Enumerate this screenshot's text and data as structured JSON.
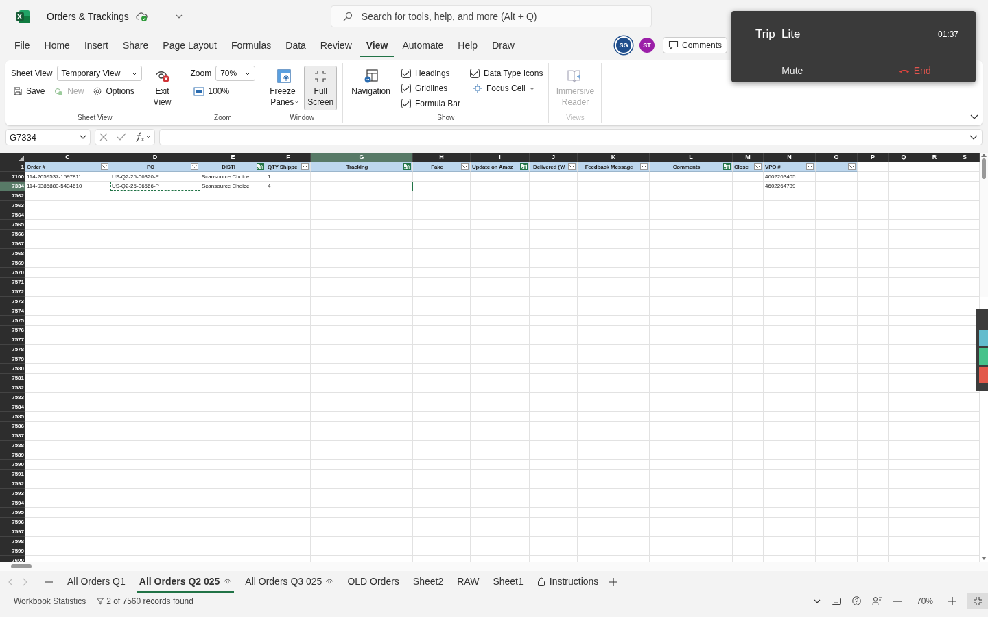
{
  "title_bar": {
    "document_title": "Orders & Trackings",
    "search": {
      "placeholder": "Search for tools, help, and more (Alt + Q)"
    }
  },
  "menu_tabs": [
    {
      "label": "File",
      "selected": false
    },
    {
      "label": "Home",
      "selected": false
    },
    {
      "label": "Insert",
      "selected": false
    },
    {
      "label": "Share",
      "selected": false
    },
    {
      "label": "Page Layout",
      "selected": false
    },
    {
      "label": "Formulas",
      "selected": false
    },
    {
      "label": "Data",
      "selected": false
    },
    {
      "label": "Review",
      "selected": false
    },
    {
      "label": "View",
      "selected": true
    },
    {
      "label": "Automate",
      "selected": false
    },
    {
      "label": "Help",
      "selected": false
    },
    {
      "label": "Draw",
      "selected": false
    }
  ],
  "collaborators": [
    {
      "initials": "SG",
      "color": "#1f4e8c"
    },
    {
      "initials": "ST",
      "color": "#9b1fa8"
    }
  ],
  "comments_button": "Comments",
  "ribbon": {
    "sheet_view": {
      "label": "Sheet View",
      "value": "Temporary View",
      "save": "Save",
      "new": {
        "label": "New",
        "disabled": true
      },
      "options": "Options",
      "exit": "Exit View",
      "group": "Sheet View"
    },
    "zoom": {
      "label": "Zoom",
      "value": "70%",
      "reset": "100%",
      "group": "Zoom"
    },
    "window": {
      "freeze": "Freeze Panes",
      "full_screen": {
        "label": "Full Screen",
        "on": true
      },
      "group": "Window"
    },
    "show": {
      "navigation": "Navigation",
      "checks": [
        {
          "label": "Headings",
          "checked": true
        },
        {
          "label": "Gridlines",
          "checked": true
        },
        {
          "label": "Formula Bar",
          "checked": true
        },
        {
          "label": "Data Type Icons",
          "checked": true
        }
      ],
      "focus_cell": "Focus Cell",
      "group": "Show"
    },
    "views": {
      "immersive": {
        "label": "Immersive Reader",
        "disabled": true
      },
      "group": "Views"
    }
  },
  "formula_bar": {
    "name_box": "G7334"
  },
  "sheet": {
    "header_row": "1",
    "columns": [
      {
        "letter": "C",
        "header": "Order #",
        "filter_button": true,
        "filtered": false,
        "selected": false
      },
      {
        "letter": "D",
        "header": "PO",
        "filter_button": true,
        "filtered": false,
        "selected": false
      },
      {
        "letter": "E",
        "header": "DISTI",
        "filter_button": true,
        "filtered": true,
        "selected": false
      },
      {
        "letter": "F",
        "header": "QTY Shippe",
        "filter_button": true,
        "filtered": false,
        "selected": false
      },
      {
        "letter": "G",
        "header": "Tracking",
        "filter_button": true,
        "filtered": true,
        "selected": true
      },
      {
        "letter": "H",
        "header": "Fake",
        "filter_button": true,
        "filtered": false,
        "selected": false
      },
      {
        "letter": "I",
        "header": "Update on Amaz",
        "filter_button": true,
        "filtered": true,
        "selected": false
      },
      {
        "letter": "J",
        "header": "Delivered (Y/",
        "filter_button": true,
        "filtered": false,
        "selected": false
      },
      {
        "letter": "K",
        "header": "Feedback Message",
        "filter_button": true,
        "filtered": false,
        "selected": false
      },
      {
        "letter": "L",
        "header": "Comments",
        "filter_button": true,
        "filtered": true,
        "selected": false
      },
      {
        "letter": "M",
        "header": "Close",
        "filter_button": true,
        "filtered": false,
        "selected": false
      },
      {
        "letter": "N",
        "header": "VPO #",
        "filter_button": true,
        "filtered": false,
        "selected": false
      },
      {
        "letter": "O",
        "filter_button": true,
        "filtered": false,
        "selected": false
      },
      {
        "letter": "P",
        "selected": false
      },
      {
        "letter": "Q",
        "selected": false
      },
      {
        "letter": "R",
        "selected": false
      },
      {
        "letter": "S",
        "selected": false
      }
    ],
    "rows": [
      {
        "number": "7100",
        "selected": false,
        "cells": {
          "C": {
            "text": "114-2659537-1597811",
            "copied": false
          },
          "D": {
            "text": "US-Q2-25-06320-P",
            "copied": false
          },
          "E": {
            "text": "Scansource Choice",
            "copied": false
          },
          "F": {
            "text": "1",
            "copied": false
          },
          "N": {
            "text": "4602263405",
            "copied": false
          }
        }
      },
      {
        "number": "7334",
        "selected": true,
        "cells": {
          "C": {
            "text": "114-9385880-5434610",
            "copied": false
          },
          "D": {
            "text": "US-Q2-25-06566-P",
            "copied": true
          },
          "E": {
            "text": "Scansource Choice",
            "copied": false
          },
          "F": {
            "text": "4",
            "copied": false
          },
          "N": {
            "text": "4602264739",
            "copied": false
          }
        }
      }
    ],
    "empty_rows": [
      "7562",
      "7563",
      "7564",
      "7565",
      "7566",
      "7567",
      "7568",
      "7569",
      "7570",
      "7571",
      "7572",
      "7573",
      "7574",
      "7575",
      "7576",
      "7577",
      "7578",
      "7579",
      "7580",
      "7581",
      "7582",
      "7583",
      "7584",
      "7585",
      "7586",
      "7587",
      "7588",
      "7589",
      "7590",
      "7591",
      "7592",
      "7593",
      "7594",
      "7595",
      "7596",
      "7597",
      "7598",
      "7599",
      "7600"
    ]
  },
  "sheet_tabs": [
    {
      "label": "All Orders Q1",
      "kind": "plain",
      "selected": false
    },
    {
      "label": "All Orders Q2 025",
      "kind": "watched",
      "selected": true
    },
    {
      "label": "All Orders Q3 025",
      "kind": "watched",
      "selected": false
    },
    {
      "label": "OLD Orders",
      "kind": "plain",
      "selected": false
    },
    {
      "label": "Sheet2",
      "kind": "plain",
      "selected": false
    },
    {
      "label": "RAW",
      "kind": "plain",
      "selected": false
    },
    {
      "label": "Sheet1",
      "kind": "plain",
      "selected": false
    },
    {
      "label": "Instructions",
      "kind": "locked",
      "selected": false
    }
  ],
  "status_bar": {
    "workbook_statistics": "Workbook Statistics",
    "filter_status": "2 of 7560 records found",
    "zoom": "70%"
  },
  "call_overlay": {
    "title": "Trip  Lite",
    "timer": "01:37",
    "mute": "Mute",
    "end": "End"
  }
}
